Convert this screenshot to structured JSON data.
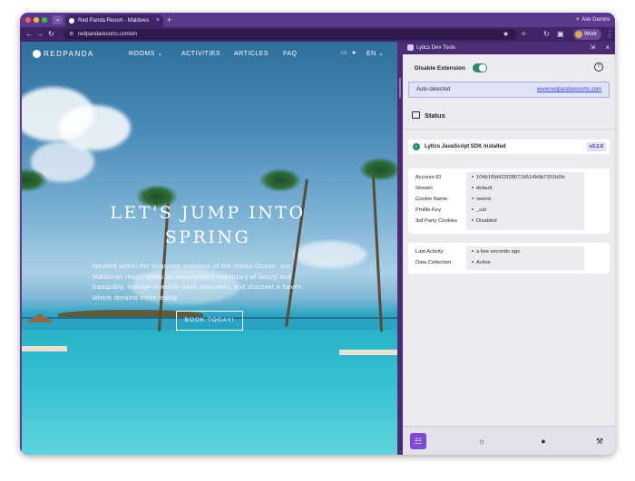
{
  "browser": {
    "tab_title": "Red Panda Resort - Maldives",
    "tab_close": "×",
    "new_tab": "+",
    "ask_label": "Ask Gemini",
    "url": "redpandaresorts.com/en",
    "profile_label": "Work",
    "tab_menu": "⌄"
  },
  "site": {
    "logo": "REDPANDA",
    "nav": [
      {
        "label": "ROOMS ⌄"
      },
      {
        "label": "ACTIVITIES"
      },
      {
        "label": "ARTICLES"
      },
      {
        "label": "FAQ"
      }
    ],
    "lang": "EN ⌄",
    "hero_title": "LET'S JUMP INTO SPRING",
    "hero_text": "Nestled within the turquoise embrace of the Indian Ocean, our Maldivian resort offers an unparalleled sanctuary of luxury and tranquility. Indulge in world-class amenities, and discover a haven where dreams meet reality.",
    "cta": "BOOK TODAY!"
  },
  "panel": {
    "title": "Lytics Dev Tools",
    "extension_label": "Disable Extension",
    "extension_enabled": true,
    "auto_detected_label": "Auto-detected",
    "auto_detected_url": "www.redpandaresorts.com",
    "status_heading": "Status",
    "sdk_status": "Lytics JavaScript SDK Installed",
    "sdk_version": "v3.1.6",
    "config": [
      {
        "key": "Account ID",
        "value": "104b1f0d422f28671b514b5b7351b5fc"
      },
      {
        "key": "Stream",
        "value": "default"
      },
      {
        "key": "Cookie Name",
        "value": "seerid"
      },
      {
        "key": "Profile Key",
        "value": "_uid"
      },
      {
        "key": "3rd Party Cookies",
        "value": "Disabled"
      }
    ],
    "activity": [
      {
        "key": "Last Activity",
        "value": "a few seconds ago"
      },
      {
        "key": "Data Collection",
        "value": "Active"
      }
    ]
  },
  "colors": {
    "browser_frame": "#5b3a8e",
    "toggle_on": "#2f8a67",
    "accent": "#7b4bd6"
  }
}
